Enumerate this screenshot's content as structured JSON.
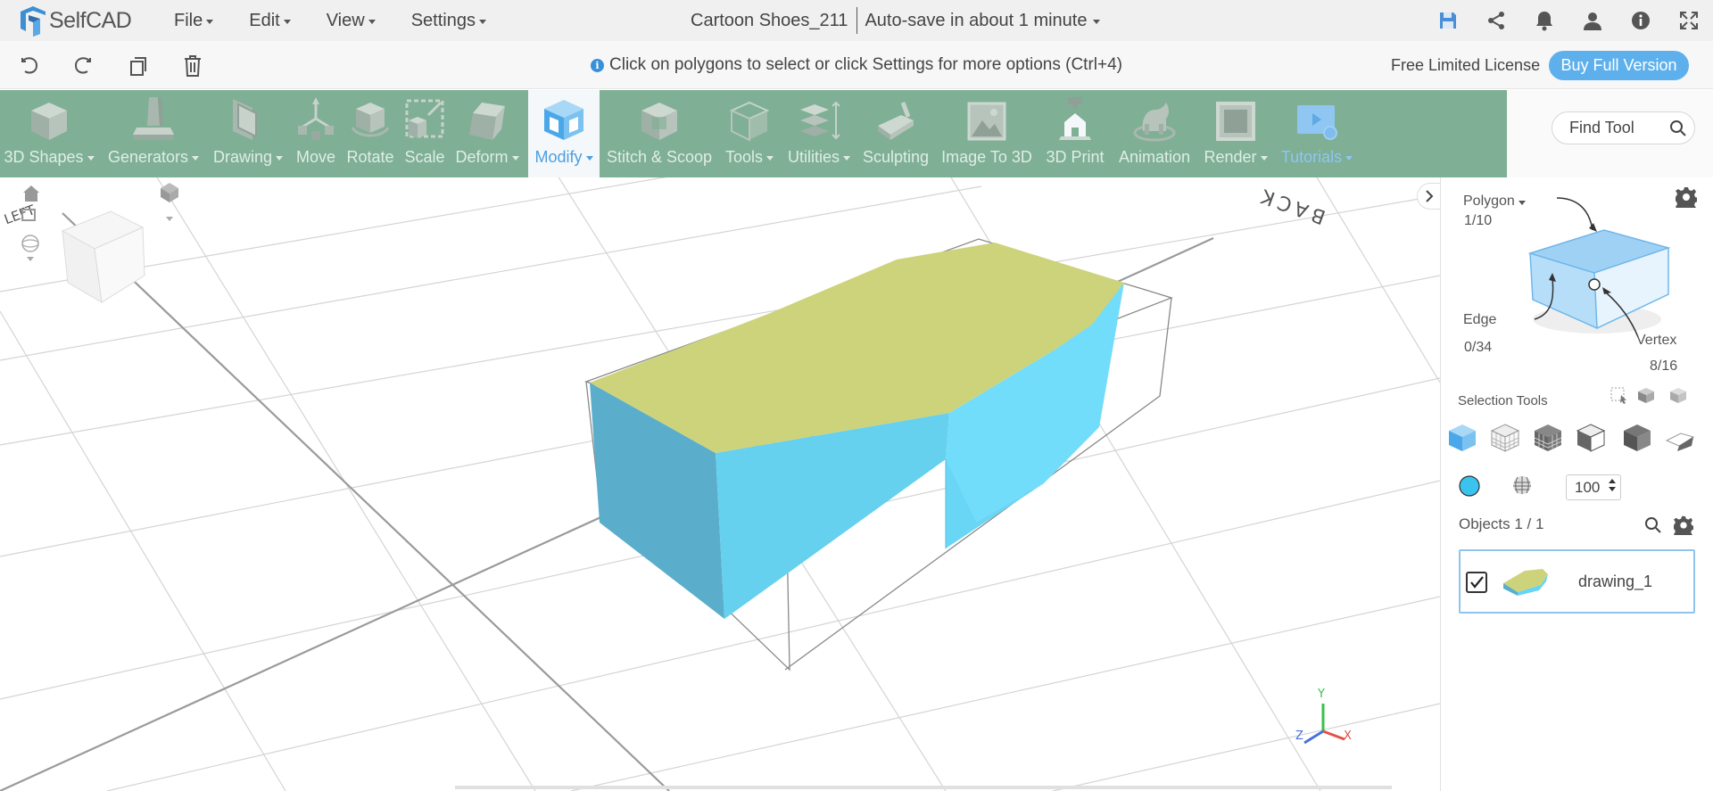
{
  "app": {
    "logo_text": "SelfCAD",
    "project_title": "Cartoon Shoes_211",
    "autosave_label": "Auto-save in about 1 minute"
  },
  "menu": [
    {
      "name": "menu-file",
      "label": "File"
    },
    {
      "name": "menu-edit",
      "label": "Edit"
    },
    {
      "name": "menu-view",
      "label": "View"
    },
    {
      "name": "menu-settings",
      "label": "Settings"
    }
  ],
  "top_icons": [
    "save-icon",
    "share-icon",
    "bell-icon",
    "user-icon",
    "info-icon",
    "fullscreen-icon"
  ],
  "secondbar": {
    "history_buttons": [
      "undo-icon",
      "redo-icon",
      "copy-icon",
      "delete-icon"
    ],
    "hint": "Click on polygons to select or click Settings for more options (Ctrl+4)",
    "license": "Free Limited License",
    "buy_label": "Buy Full Version"
  },
  "toolbar": {
    "tools": [
      {
        "name": "tool-3d-shapes",
        "label": "3D Shapes",
        "dropdown": true
      },
      {
        "name": "tool-generators",
        "label": "Generators",
        "dropdown": true
      },
      {
        "name": "tool-drawing",
        "label": "Drawing",
        "dropdown": true
      },
      {
        "name": "tool-move",
        "label": "Move",
        "dropdown": false
      },
      {
        "name": "tool-rotate",
        "label": "Rotate",
        "dropdown": false
      },
      {
        "name": "tool-scale",
        "label": "Scale",
        "dropdown": false
      },
      {
        "name": "tool-deform",
        "label": "Deform",
        "dropdown": true
      },
      {
        "name": "tool-modify",
        "label": "Modify",
        "dropdown": true,
        "active": true
      },
      {
        "name": "tool-stitch-scoop",
        "label": "Stitch & Scoop",
        "dropdown": false
      },
      {
        "name": "tool-tools",
        "label": "Tools",
        "dropdown": true
      },
      {
        "name": "tool-utilities",
        "label": "Utilities",
        "dropdown": true
      },
      {
        "name": "tool-sculpting",
        "label": "Sculpting",
        "dropdown": false
      },
      {
        "name": "tool-image-to-3d",
        "label": "Image To 3D",
        "dropdown": false
      },
      {
        "name": "tool-3d-print",
        "label": "3D Print",
        "dropdown": false
      },
      {
        "name": "tool-animation",
        "label": "Animation",
        "dropdown": false
      },
      {
        "name": "tool-render",
        "label": "Render",
        "dropdown": true
      },
      {
        "name": "tool-tutorials",
        "label": "Tutorials",
        "dropdown": true
      }
    ],
    "find_tool_placeholder": "Find Tool"
  },
  "viewport": {
    "view_cube_labels": {
      "left": "LEFT",
      "back": "BACK"
    },
    "axis_labels": {
      "x": "X",
      "y": "Y",
      "z": "Z"
    },
    "colors": {
      "top_face": "#cdd37a",
      "side_face": "#66d4f2",
      "dark_side": "#5aaecb"
    }
  },
  "panel": {
    "polygon_label": "Polygon",
    "polygon_count": "1/10",
    "edge_label": "Edge",
    "edge_count": "0/34",
    "vertex_label": "Vertex",
    "vertex_count": "8/16",
    "selection_tools_label": "Selection Tools",
    "brush_size": "100",
    "objects_label": "Objects 1 / 1",
    "objects": [
      {
        "name": "drawing_1",
        "checked": true
      }
    ]
  },
  "colors": {
    "toolbar_bg": "#7faf95",
    "accent": "#5eb0ec",
    "selection_blue": "#4db6e8"
  }
}
